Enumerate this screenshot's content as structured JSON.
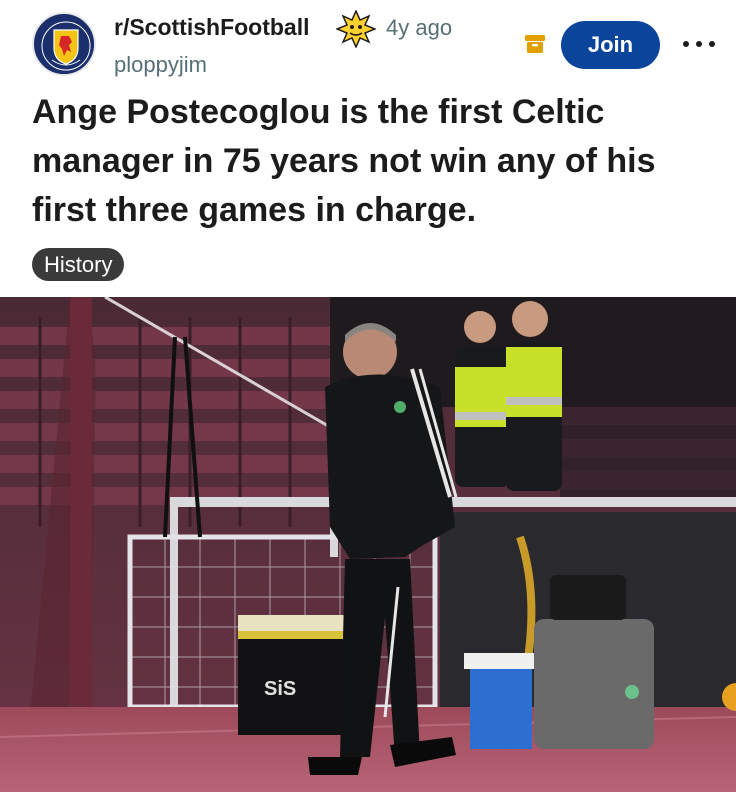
{
  "post": {
    "subreddit": "r/ScottishFootball",
    "age": "4y ago",
    "author": "ploppyjim",
    "title": "Ange Postecoglou is the first Celtic manager in 75 years not win any of his first three games in charge.",
    "flair": "History"
  },
  "actions": {
    "join_label": "Join"
  },
  "icons": {
    "award": "award-icon",
    "archive": "archive-icon",
    "more": "more-options-icon"
  },
  "image": {
    "sponsor_logo": "SiS"
  },
  "colors": {
    "join_button": "#0a449b",
    "flair_background": "#3a3a3a",
    "meta_text": "#576f76"
  }
}
